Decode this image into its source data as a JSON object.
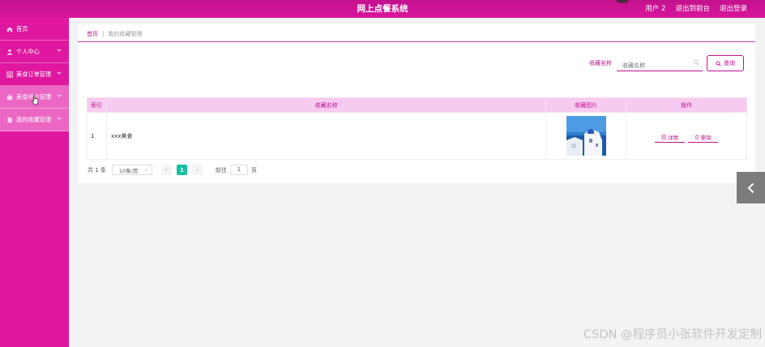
{
  "header": {
    "title": "网上点餐系统",
    "links": [
      "用户 2",
      "退出到前台",
      "退出登录"
    ]
  },
  "sidebar": {
    "items": [
      {
        "label": "首页",
        "icon": "home-icon"
      },
      {
        "label": "个人中心",
        "icon": "user-icon"
      },
      {
        "label": "美食订单管理",
        "icon": "list-icon"
      },
      {
        "label": "美食评价管理",
        "icon": "briefcase-icon"
      },
      {
        "label": "我的收藏管理",
        "icon": "doc-icon"
      }
    ]
  },
  "breadcrumb": {
    "home": "首页",
    "separator": "|",
    "current": "我的收藏管理"
  },
  "search": {
    "label": "收藏名称",
    "placeholder": "收藏名称",
    "button_label": "查询"
  },
  "table": {
    "columns": [
      "索引",
      "收藏名称",
      "收藏图片",
      "操作"
    ],
    "rows": [
      {
        "index": "1",
        "name": "xxx美食",
        "actions": [
          "详情",
          "删除"
        ]
      }
    ]
  },
  "pagination": {
    "total_text": "共 1 条",
    "page_size": "10条/页",
    "current_page": "1",
    "goto_label": "前往",
    "goto_value": "1",
    "page_suffix": "页"
  },
  "watermark": "CSDN @程序员小张软件开发定制",
  "colors": {
    "primary": "#c2128e",
    "sidebar": "#e0179f",
    "table_header": "#f7caf2",
    "active_page": "#13c0a0"
  }
}
